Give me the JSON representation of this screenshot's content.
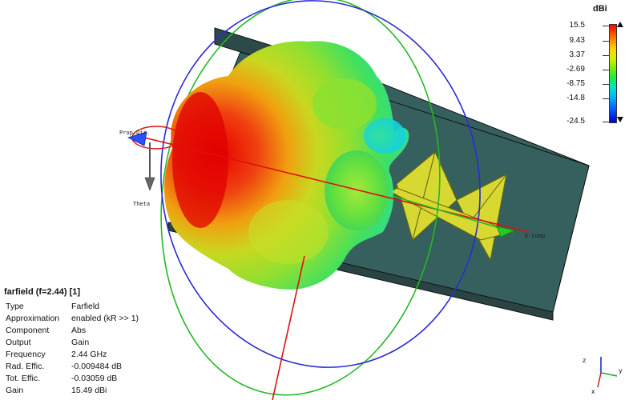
{
  "axis_labels": {
    "prop_dir": "Prop.Dir.",
    "theta": "Theta",
    "e_comp": "E-Comp"
  },
  "legend": {
    "title": "dBi",
    "ticks": [
      "15.5",
      "9.43",
      "3.37",
      "-2.69",
      "-8.75",
      "-14.8",
      "-24.5"
    ]
  },
  "info": {
    "title": "farfield (f=2.44) [1]",
    "rows": [
      {
        "key": "Type",
        "value": "Farfield"
      },
      {
        "key": "Approximation",
        "value": "enabled (kR >> 1)"
      },
      {
        "key": "Component",
        "value": "Abs"
      },
      {
        "key": "Output",
        "value": "Gain"
      },
      {
        "key": "Frequency",
        "value": "2.44 GHz"
      },
      {
        "key": "Rad. Effic.",
        "value": "-0.009484 dB"
      },
      {
        "key": "Tot. Effic.",
        "value": "-0.03059 dB"
      },
      {
        "key": "Gain",
        "value": "15.49 dBi"
      }
    ]
  },
  "mini_axes": {
    "x": "x",
    "y": "y",
    "z": "z"
  },
  "colors": {
    "substrate_top": "#2c4a4a",
    "substrate_side": "#36605e",
    "dipole": "#d8d832",
    "circle_green": "#22b922",
    "circle_blue": "#2a2ad6",
    "axis_red": "#dd1111"
  }
}
